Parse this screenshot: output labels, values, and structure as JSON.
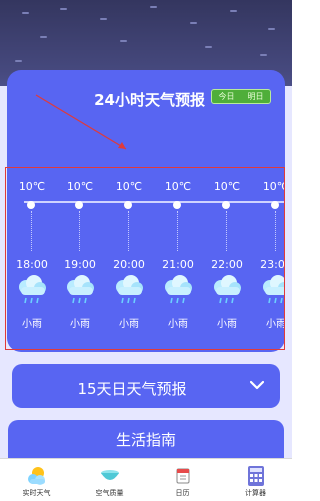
{
  "hourly": {
    "title": "24小时天气预报",
    "toggle": {
      "left": "今日",
      "right": "明日"
    },
    "items": [
      {
        "temp": "10℃",
        "time": "18:00",
        "icon": "light-rain-icon",
        "condition": "小雨"
      },
      {
        "temp": "10℃",
        "time": "19:00",
        "icon": "light-rain-icon",
        "condition": "小雨"
      },
      {
        "temp": "10℃",
        "time": "20:00",
        "icon": "light-rain-icon",
        "condition": "小雨"
      },
      {
        "temp": "10℃",
        "time": "21:00",
        "icon": "light-rain-icon",
        "condition": "小雨"
      },
      {
        "temp": "10℃",
        "time": "22:00",
        "icon": "light-rain-icon",
        "condition": "小雨"
      },
      {
        "temp": "10℃",
        "time": "23:00",
        "icon": "light-rain-icon",
        "condition": "小雨"
      }
    ]
  },
  "forecast15": {
    "title": "15天日天气预报"
  },
  "life": {
    "title": "生活指南"
  },
  "nav": {
    "items": [
      {
        "label": "实时天气",
        "icon": "sun-cloud-icon"
      },
      {
        "label": "空气质量",
        "icon": "bowl-icon"
      },
      {
        "label": "日历",
        "icon": "calendar-icon"
      },
      {
        "label": "计算器",
        "icon": "calculator-icon"
      }
    ]
  },
  "colors": {
    "card": "#5865f2",
    "sky": "#46497e",
    "highlight_box": "#e03a3a",
    "toggle": "#4fae3a"
  }
}
